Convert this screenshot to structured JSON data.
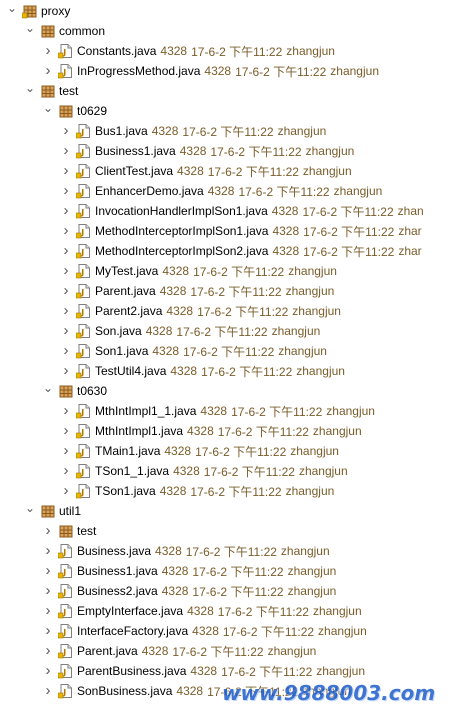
{
  "tree": [
    {
      "depth": 0,
      "expanded": true,
      "kind": "project",
      "label": "proxy",
      "name": "project-proxy"
    },
    {
      "depth": 1,
      "expanded": true,
      "kind": "package",
      "label": "common",
      "name": "package-common"
    },
    {
      "depth": 2,
      "kind": "file",
      "label": "Constants.java",
      "rev": "4328",
      "date": "17-6-2 下午11:22",
      "author": "zhangjun",
      "name": "file-constants"
    },
    {
      "depth": 2,
      "kind": "file",
      "label": "InProgressMethod.java",
      "rev": "4328",
      "date": "17-6-2 下午11:22",
      "author": "zhangjun",
      "name": "file-inprogressmethod"
    },
    {
      "depth": 1,
      "expanded": true,
      "kind": "package",
      "label": "test",
      "name": "package-test"
    },
    {
      "depth": 2,
      "expanded": true,
      "kind": "package",
      "label": "t0629",
      "name": "package-t0629"
    },
    {
      "depth": 3,
      "kind": "file",
      "label": "Bus1.java",
      "rev": "4328",
      "date": "17-6-2 下午11:22",
      "author": "zhangjun",
      "name": "file-bus1"
    },
    {
      "depth": 3,
      "kind": "file",
      "label": "Business1.java",
      "rev": "4328",
      "date": "17-6-2 下午11:22",
      "author": "zhangjun",
      "name": "file-business1-t0629"
    },
    {
      "depth": 3,
      "kind": "file",
      "label": "ClientTest.java",
      "rev": "4328",
      "date": "17-6-2 下午11:22",
      "author": "zhangjun",
      "name": "file-clienttest"
    },
    {
      "depth": 3,
      "kind": "file",
      "label": "EnhancerDemo.java",
      "rev": "4328",
      "date": "17-6-2 下午11:22",
      "author": "zhangjun",
      "name": "file-enhancerdemo"
    },
    {
      "depth": 3,
      "kind": "file",
      "label": "InvocationHandlerImplSon1.java",
      "rev": "4328",
      "date": "17-6-2 下午11:22",
      "author": "zhan",
      "name": "file-invocationhandlerimplson1"
    },
    {
      "depth": 3,
      "kind": "file",
      "label": "MethodInterceptorImplSon1.java",
      "rev": "4328",
      "date": "17-6-2 下午11:22",
      "author": "zhar",
      "name": "file-methodinterceptorimplson1"
    },
    {
      "depth": 3,
      "kind": "file",
      "label": "MethodInterceptorImplSon2.java",
      "rev": "4328",
      "date": "17-6-2 下午11:22",
      "author": "zhar",
      "name": "file-methodinterceptorimplson2"
    },
    {
      "depth": 3,
      "kind": "file",
      "label": "MyTest.java",
      "rev": "4328",
      "date": "17-6-2 下午11:22",
      "author": "zhangjun",
      "name": "file-mytest"
    },
    {
      "depth": 3,
      "kind": "file",
      "label": "Parent.java",
      "rev": "4328",
      "date": "17-6-2 下午11:22",
      "author": "zhangjun",
      "name": "file-parent-t0629"
    },
    {
      "depth": 3,
      "kind": "file",
      "label": "Parent2.java",
      "rev": "4328",
      "date": "17-6-2 下午11:22",
      "author": "zhangjun",
      "name": "file-parent2"
    },
    {
      "depth": 3,
      "kind": "file",
      "label": "Son.java",
      "rev": "4328",
      "date": "17-6-2 下午11:22",
      "author": "zhangjun",
      "name": "file-son"
    },
    {
      "depth": 3,
      "kind": "file",
      "label": "Son1.java",
      "rev": "4328",
      "date": "17-6-2 下午11:22",
      "author": "zhangjun",
      "name": "file-son1"
    },
    {
      "depth": 3,
      "kind": "file",
      "label": "TestUtil4.java",
      "rev": "4328",
      "date": "17-6-2 下午11:22",
      "author": "zhangjun",
      "name": "file-testutil4"
    },
    {
      "depth": 2,
      "expanded": true,
      "kind": "package",
      "label": "t0630",
      "name": "package-t0630"
    },
    {
      "depth": 3,
      "kind": "file",
      "label": "MthIntImpl1_1.java",
      "rev": "4328",
      "date": "17-6-2 下午11:22",
      "author": "zhangjun",
      "name": "file-mthintimpl1-1"
    },
    {
      "depth": 3,
      "kind": "file",
      "label": "MthIntImpl1.java",
      "rev": "4328",
      "date": "17-6-2 下午11:22",
      "author": "zhangjun",
      "name": "file-mthintimpl1"
    },
    {
      "depth": 3,
      "kind": "file",
      "label": "TMain1.java",
      "rev": "4328",
      "date": "17-6-2 下午11:22",
      "author": "zhangjun",
      "name": "file-tmain1"
    },
    {
      "depth": 3,
      "kind": "file",
      "label": "TSon1_1.java",
      "rev": "4328",
      "date": "17-6-2 下午11:22",
      "author": "zhangjun",
      "name": "file-tson1-1"
    },
    {
      "depth": 3,
      "kind": "file",
      "label": "TSon1.java",
      "rev": "4328",
      "date": "17-6-2 下午11:22",
      "author": "zhangjun",
      "name": "file-tson1"
    },
    {
      "depth": 1,
      "expanded": true,
      "kind": "package",
      "label": "util1",
      "name": "package-util1"
    },
    {
      "depth": 2,
      "expanded": false,
      "kind": "package",
      "label": "test",
      "name": "package-util1-test"
    },
    {
      "depth": 2,
      "kind": "file",
      "label": "Business.java",
      "rev": "4328",
      "date": "17-6-2 下午11:22",
      "author": "zhangjun",
      "name": "file-business"
    },
    {
      "depth": 2,
      "kind": "file",
      "label": "Business1.java",
      "rev": "4328",
      "date": "17-6-2 下午11:22",
      "author": "zhangjun",
      "name": "file-business1-util1"
    },
    {
      "depth": 2,
      "kind": "file",
      "label": "Business2.java",
      "rev": "4328",
      "date": "17-6-2 下午11:22",
      "author": "zhangjun",
      "name": "file-business2"
    },
    {
      "depth": 2,
      "kind": "file",
      "label": "EmptyInterface.java",
      "rev": "4328",
      "date": "17-6-2 下午11:22",
      "author": "zhangjun",
      "name": "file-emptyinterface"
    },
    {
      "depth": 2,
      "kind": "file",
      "label": "InterfaceFactory.java",
      "rev": "4328",
      "date": "17-6-2 下午11:22",
      "author": "zhangjun",
      "name": "file-interfacefactory"
    },
    {
      "depth": 2,
      "kind": "file",
      "label": "Parent.java",
      "rev": "4328",
      "date": "17-6-2 下午11:22",
      "author": "zhangjun",
      "name": "file-parent-util1"
    },
    {
      "depth": 2,
      "kind": "file",
      "label": "ParentBusiness.java",
      "rev": "4328",
      "date": "17-6-2 下午11:22",
      "author": "zhangjun",
      "name": "file-parentbusiness"
    },
    {
      "depth": 2,
      "kind": "file",
      "label": "SonBusiness.java",
      "rev": "4328",
      "date": "17-6-2 下午11:22",
      "author": "zhangjun",
      "name": "file-sonbusiness"
    }
  ],
  "watermark": "www.9888003.com",
  "colors": {
    "package_icon": "#8a5a1c",
    "java_icon_accent": "#e8b400",
    "tree_twisty": "#595959"
  }
}
